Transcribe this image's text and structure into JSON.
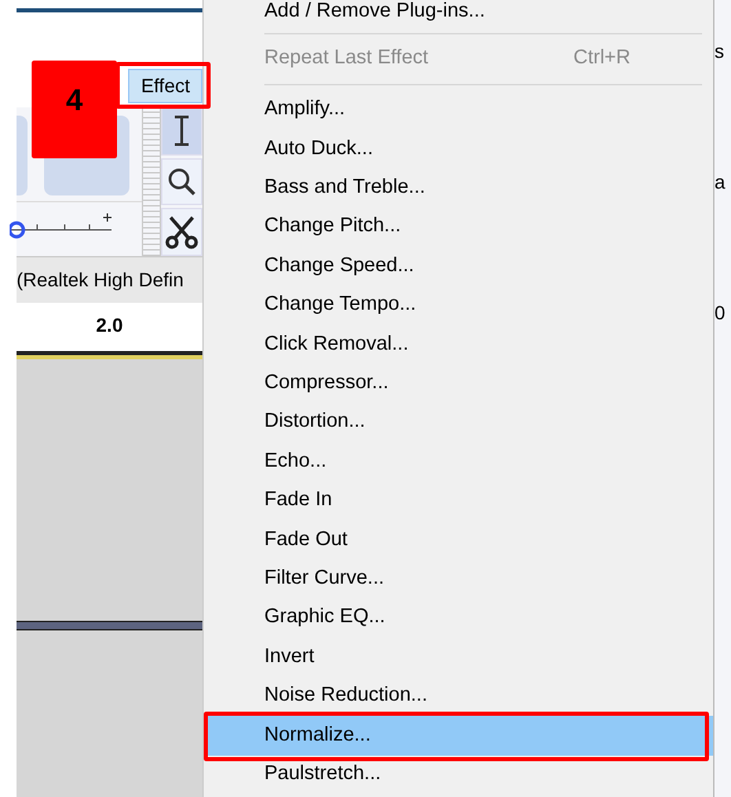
{
  "app": {
    "menu_button": "Effect",
    "menu_button_selected": true,
    "device": "(Realtek High Defin",
    "ruler_tick": "2.0",
    "right_edge_texts": [
      "s",
      "a",
      "0"
    ],
    "volume_slider": {
      "level": 0
    }
  },
  "callout": {
    "number": "4"
  },
  "menu": {
    "items": [
      {
        "kind": "item",
        "label": "Add / Remove Plug-ins...",
        "disabled": false,
        "selected": false
      },
      {
        "kind": "separator"
      },
      {
        "kind": "item",
        "label": "Repeat Last Effect",
        "shortcut": "Ctrl+R",
        "disabled": true,
        "selected": false
      },
      {
        "kind": "separator"
      },
      {
        "kind": "item",
        "label": "Amplify...",
        "disabled": false,
        "selected": false
      },
      {
        "kind": "item",
        "label": "Auto Duck...",
        "disabled": false,
        "selected": false
      },
      {
        "kind": "item",
        "label": "Bass and Treble...",
        "disabled": false,
        "selected": false
      },
      {
        "kind": "item",
        "label": "Change Pitch...",
        "disabled": false,
        "selected": false
      },
      {
        "kind": "item",
        "label": "Change Speed...",
        "disabled": false,
        "selected": false
      },
      {
        "kind": "item",
        "label": "Change Tempo...",
        "disabled": false,
        "selected": false
      },
      {
        "kind": "item",
        "label": "Click Removal...",
        "disabled": false,
        "selected": false
      },
      {
        "kind": "item",
        "label": "Compressor...",
        "disabled": false,
        "selected": false
      },
      {
        "kind": "item",
        "label": "Distortion...",
        "disabled": false,
        "selected": false
      },
      {
        "kind": "item",
        "label": "Echo...",
        "disabled": false,
        "selected": false
      },
      {
        "kind": "item",
        "label": "Fade In",
        "disabled": false,
        "selected": false
      },
      {
        "kind": "item",
        "label": "Fade Out",
        "disabled": false,
        "selected": false
      },
      {
        "kind": "item",
        "label": "Filter Curve...",
        "disabled": false,
        "selected": false
      },
      {
        "kind": "item",
        "label": "Graphic EQ...",
        "disabled": false,
        "selected": false
      },
      {
        "kind": "item",
        "label": "Invert",
        "disabled": false,
        "selected": false
      },
      {
        "kind": "item",
        "label": "Noise Reduction...",
        "disabled": false,
        "selected": false
      },
      {
        "kind": "item",
        "label": "Normalize...",
        "disabled": false,
        "selected": true
      },
      {
        "kind": "item",
        "label": "Paulstretch...",
        "disabled": false,
        "selected": false
      }
    ]
  }
}
